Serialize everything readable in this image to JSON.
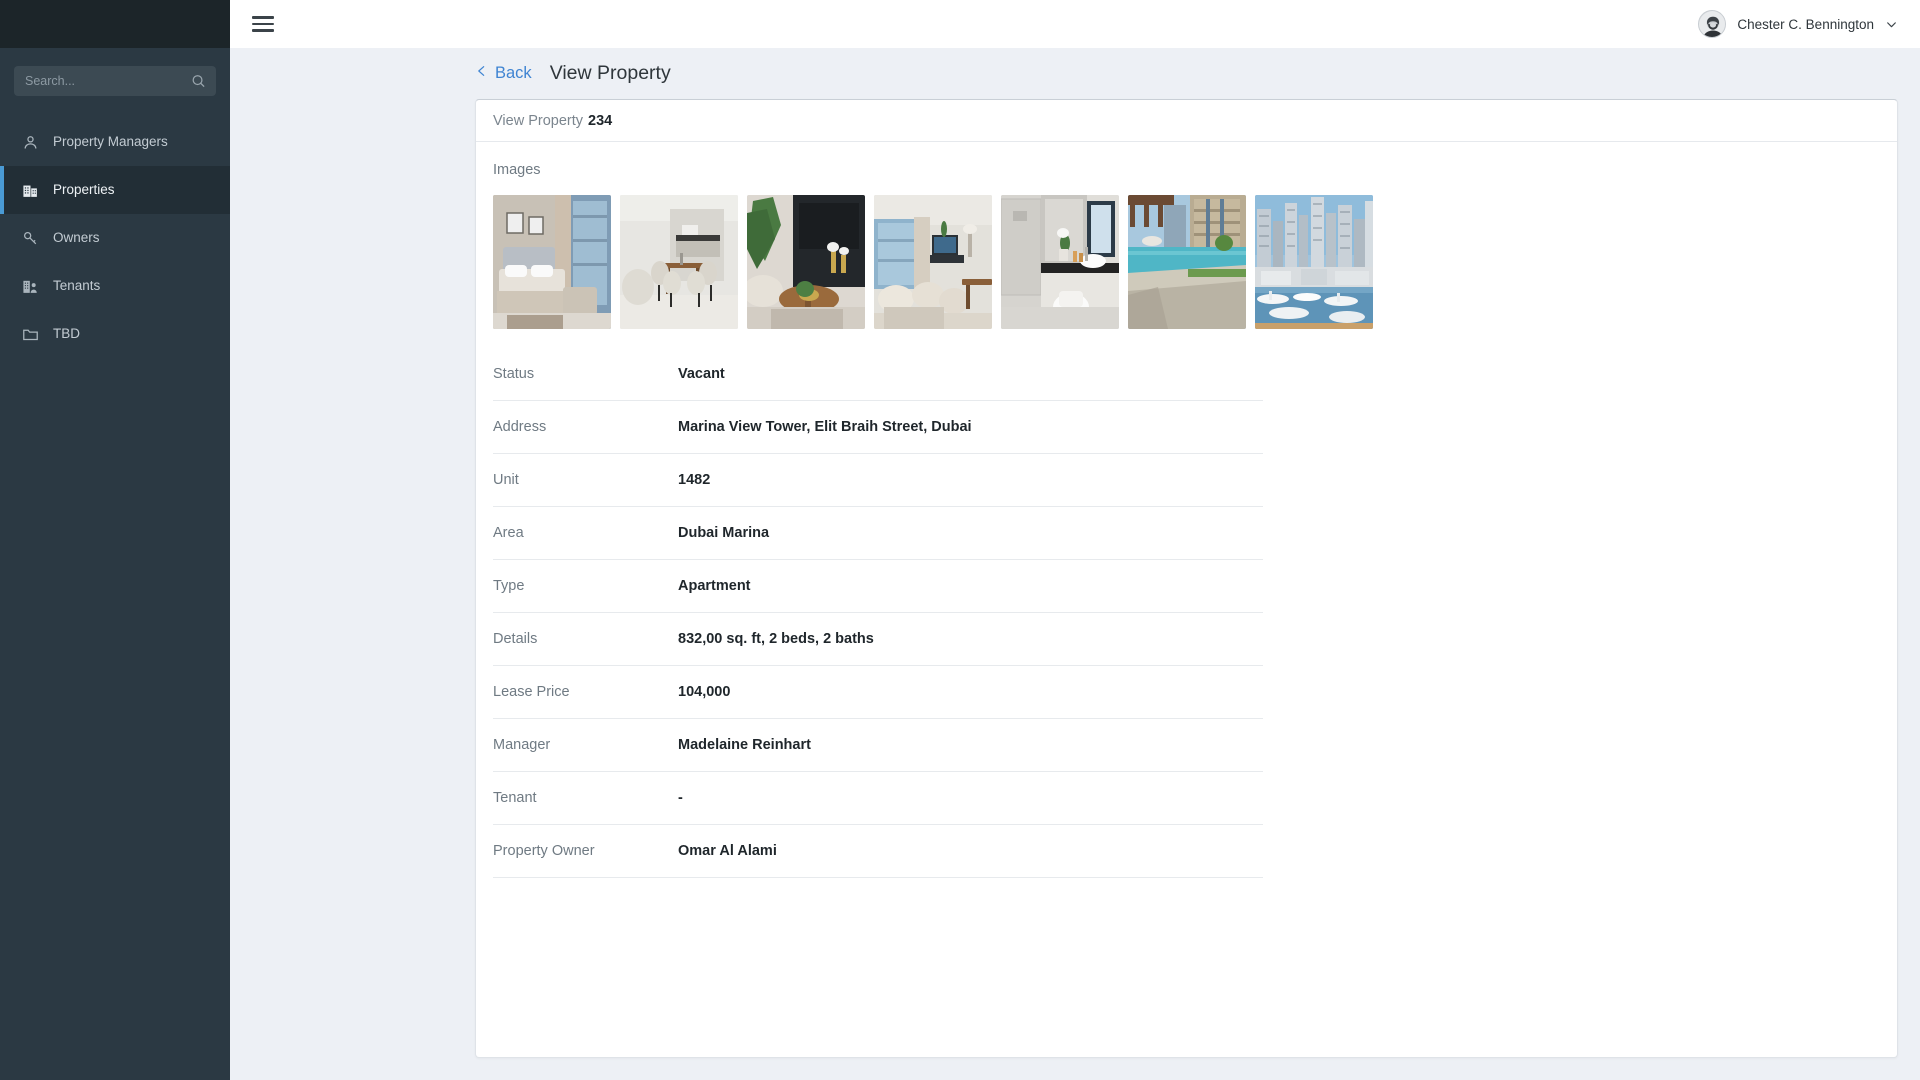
{
  "sidebar": {
    "search": {
      "placeholder": "Search...",
      "value": ""
    },
    "items": [
      {
        "label": "Property Managers",
        "icon": "user-icon",
        "active": false
      },
      {
        "label": "Properties",
        "icon": "buildings-icon",
        "active": true
      },
      {
        "label": "Owners",
        "icon": "key-icon",
        "active": false
      },
      {
        "label": "Tenants",
        "icon": "building-user-icon",
        "active": false
      },
      {
        "label": "TBD",
        "icon": "folder-icon",
        "active": false
      }
    ],
    "accent_color": "#4a9ad4",
    "background_color": "#2b3943"
  },
  "topbar": {
    "menu_icon": "hamburger-icon",
    "user_name": "Chester C. Bennington",
    "chevron_icon": "chevron-down-icon",
    "avatar_icon": "user-avatar"
  },
  "page": {
    "back_label": "Back",
    "back_icon": "chevron-left-icon",
    "back_color": "#3f84d2",
    "title": "View Property"
  },
  "card": {
    "heading_prefix": "View Property",
    "heading_id": "234",
    "images_label": "Images",
    "images": [
      {
        "name": "bedroom-photo",
        "scene": "bedroom"
      },
      {
        "name": "dining-area-photo",
        "scene": "dining"
      },
      {
        "name": "living-room-photo",
        "scene": "living"
      },
      {
        "name": "lounge-photo",
        "scene": "lounge"
      },
      {
        "name": "bathroom-photo",
        "scene": "bathroom"
      },
      {
        "name": "pool-photo",
        "scene": "pool"
      },
      {
        "name": "marina-view-photo",
        "scene": "marina"
      }
    ],
    "details": [
      {
        "label": "Status",
        "value": "Vacant"
      },
      {
        "label": "Address",
        "value": "Marina View Tower, Elit Braih Street, Dubai"
      },
      {
        "label": "Unit",
        "value": "1482"
      },
      {
        "label": "Area",
        "value": "Dubai Marina"
      },
      {
        "label": "Type",
        "value": "Apartment"
      },
      {
        "label": "Details",
        "value": "832,00 sq. ft, 2 beds, 2 baths"
      },
      {
        "label": "Lease Price",
        "value": "104,000"
      },
      {
        "label": "Manager",
        "value": "Madelaine Reinhart"
      },
      {
        "label": "Tenant",
        "value": "-"
      },
      {
        "label": "Property Owner",
        "value": "Omar Al Alami"
      }
    ]
  }
}
